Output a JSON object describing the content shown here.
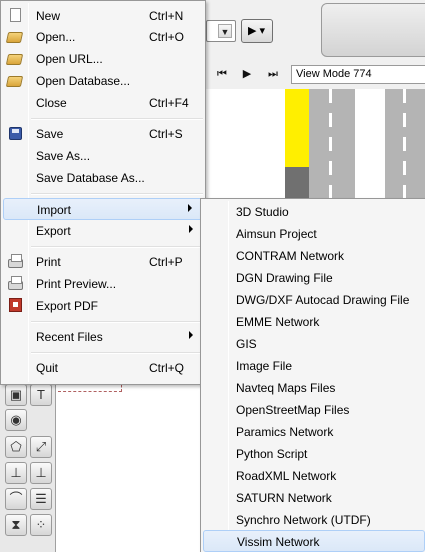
{
  "background": {
    "view_mode": "View Mode 774",
    "colors": {
      "road_marking_yellow": "#ffef00",
      "lane_gray": "#b4b4b4"
    }
  },
  "file_menu": {
    "items": [
      {
        "label": "New",
        "shortcut": "Ctrl+N",
        "icon": "new-document-icon"
      },
      {
        "label": "Open...",
        "shortcut": "Ctrl+O",
        "icon": "open-folder-icon"
      },
      {
        "label": "Open URL...",
        "shortcut": "",
        "icon": "open-folder-icon"
      },
      {
        "label": "Open Database...",
        "shortcut": "",
        "icon": "open-folder-icon"
      },
      {
        "label": "Close",
        "shortcut": "Ctrl+F4",
        "icon": ""
      },
      {
        "label": "Save",
        "shortcut": "Ctrl+S",
        "icon": "save-disk-icon"
      },
      {
        "label": "Save As...",
        "shortcut": "",
        "icon": ""
      },
      {
        "label": "Save Database As...",
        "shortcut": "",
        "icon": ""
      },
      {
        "label": "Import",
        "shortcut": "",
        "icon": "",
        "submenu": true,
        "highlighted": true
      },
      {
        "label": "Export",
        "shortcut": "",
        "icon": "",
        "submenu": true
      },
      {
        "label": "Print",
        "shortcut": "Ctrl+P",
        "icon": "printer-icon"
      },
      {
        "label": "Print Preview...",
        "shortcut": "",
        "icon": "print-preview-icon"
      },
      {
        "label": "Export PDF",
        "shortcut": "",
        "icon": "pdf-icon"
      },
      {
        "label": "Recent Files",
        "shortcut": "",
        "icon": "",
        "submenu": true
      },
      {
        "label": "Quit",
        "shortcut": "Ctrl+Q",
        "icon": ""
      }
    ]
  },
  "import_menu": {
    "items": [
      "3D Studio",
      "Aimsun Project",
      "CONTRAM Network",
      "DGN Drawing File",
      "DWG/DXF Autocad Drawing File",
      "EMME Network",
      "GIS",
      "Image File",
      "Navteq Maps Files",
      "OpenStreetMap Files",
      "Paramics Network",
      "Python Script",
      "RoadXML Network",
      "SATURN Network",
      "Synchro Network (UTDF)",
      "Vissim Network"
    ],
    "highlighted_item": "Vissim Network"
  }
}
